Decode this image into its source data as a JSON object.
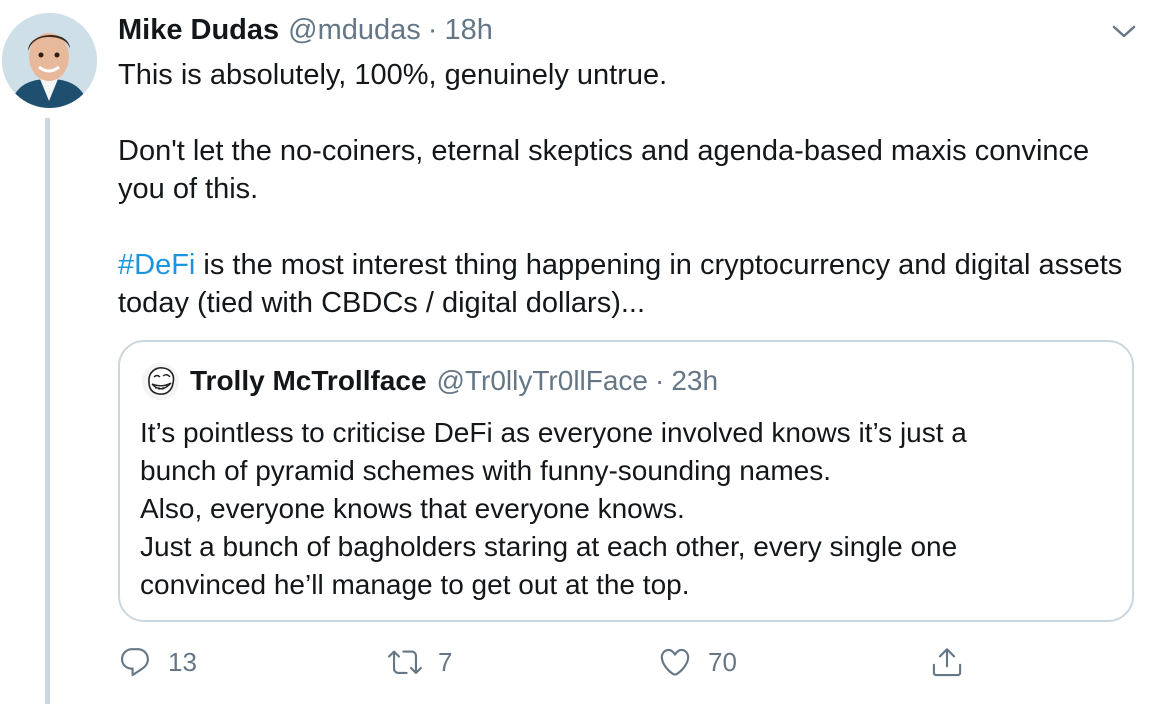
{
  "tweet": {
    "author_name": "Mike Dudas",
    "author_handle": "@mdudas",
    "separator": "·",
    "time": "18h",
    "text_line1": "This is absolutely, 100%, genuinely untrue.",
    "text_para2": "Don't let the no-coiners, eternal skeptics and agenda-based maxis convince you of this.",
    "hashtag": "#DeFi",
    "text_para3_rest": " is the most interest thing happening in cryptocurrency and digital assets today (tied with CBDCs / digital dollars)...",
    "icons": {
      "menu": "chevron-down-icon",
      "avatar": "avatar"
    }
  },
  "quoted": {
    "author_name": "Trolly McTrollface",
    "author_handle": "@Tr0llyTr0llFace",
    "separator": "·",
    "time": "23h",
    "lines": [
      "It’s pointless to criticise DeFi as everyone involved knows it’s just a",
      "bunch of pyramid schemes with funny-sounding names.",
      "Also, everyone knows that everyone knows.",
      "Just a bunch of bagholders staring at each other, every single one",
      "convinced he’ll manage to get out at the top."
    ]
  },
  "actions": {
    "reply": {
      "icon": "reply-icon",
      "count": "13"
    },
    "retweet": {
      "icon": "retweet-icon",
      "count": "7"
    },
    "like": {
      "icon": "heart-icon",
      "count": "70"
    },
    "share": {
      "icon": "share-icon"
    }
  },
  "colors": {
    "text": "#14171a",
    "secondary": "#657786",
    "link": "#1b95e0",
    "border": "#ccd6dd",
    "thread_line": "#ccd6dd"
  }
}
